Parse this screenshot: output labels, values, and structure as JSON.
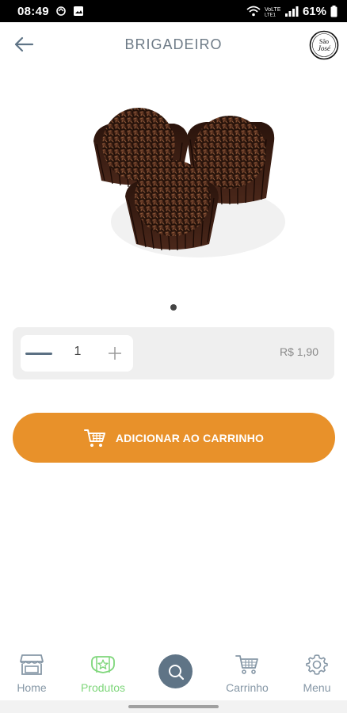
{
  "status_bar": {
    "time": "08:49",
    "battery": "61%"
  },
  "header": {
    "title": "BRIGADEIRO",
    "back_icon": "arrow-left-icon",
    "logo_text_line1": "São",
    "logo_text_line2": "José"
  },
  "product": {
    "image": "brigadeiro-chocolate-truffles",
    "carousel_active_index": 0
  },
  "quantity": {
    "value": "1",
    "price": "R$ 1,90"
  },
  "cart_button": {
    "label": "ADICIONAR AO CARRINHO",
    "icon": "cart-icon"
  },
  "nav": {
    "items": [
      {
        "label": "Home",
        "icon": "store-icon"
      },
      {
        "label": "Produtos",
        "icon": "products-icon",
        "active": true
      },
      {
        "label": "",
        "icon": "search-icon"
      },
      {
        "label": "Carrinho",
        "icon": "cart-icon"
      },
      {
        "label": "Menu",
        "icon": "gear-icon"
      }
    ]
  },
  "colors": {
    "accent": "#e8912a",
    "nav_active": "#7ed67a",
    "nav_inactive": "#8697a6",
    "title": "#6e7b87"
  }
}
